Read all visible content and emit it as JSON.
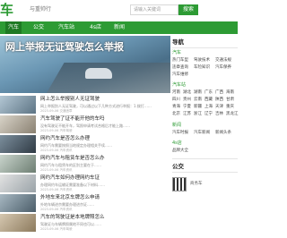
{
  "header": {
    "logo": "车",
    "tagline": "与重帅行",
    "search_placeholder": "请输入关键词",
    "search_button": "搜索"
  },
  "nav": [
    "汽车",
    "公交",
    "汽车站",
    "4s店",
    "新闻"
  ],
  "banner": {
    "title": "网上举报无证驾驶怎么举报"
  },
  "articles": [
    {
      "title": "网上怎么举报别人无证驾驶",
      "desc": "网上举报别人无证驾驶，可以通过以下几种方式进行举报：1.拨打……",
      "meta": "2023-09-06 交通违章"
    },
    {
      "title": "汽车驾驶了证不能开他的车吗",
      "desc": "没有驾驶证不能开车，驾照申请考试合格后才能上路……",
      "meta": "2023-09-06 汽车驾驶"
    },
    {
      "title": "网约汽车是否怎么办理",
      "desc": "网约汽车需要按照当地规定办理相关手续……",
      "meta": "2023-09-06 汽车资讯"
    },
    {
      "title": "网约汽车与租赁车是否怎么办",
      "desc": "网约汽车与租赁车的区别主要在于……",
      "meta": "2023-09-06 汽车资讯"
    },
    {
      "title": "网约汽车如何办理网约车证",
      "desc": "办理网约车运输证需要准备以下材料……",
      "meta": "2023-09-06 汽车资讯"
    },
    {
      "title": "外地车来北京车牌怎么申请",
      "desc": "外地车辆进京需要办理进京证……",
      "meta": "2023-09-06 汽车资讯"
    },
    {
      "title": "汽车的驾驶证是本地牌照怎么",
      "desc": "驾驶证与车辆牌照属地不同也可以……",
      "meta": "2023-09-06 汽车驾驶"
    }
  ],
  "sidebar": {
    "nav_title": "导航",
    "car_label": "汽车",
    "car_links": [
      "热门车型",
      "驾驶技术",
      "交通法规",
      "违章查询",
      "车险知识",
      "汽车保养",
      "汽车维修"
    ],
    "region_label": "汽车站",
    "regions": [
      "河南",
      "湖北",
      "湖南",
      "广东",
      "广西",
      "海南",
      "四川",
      "贵州",
      "云南",
      "西藏",
      "陕西",
      "甘肃",
      "青海",
      "宁夏",
      "新疆",
      "上海",
      "天津",
      "重庆",
      "北京",
      "江苏",
      "浙江",
      "辽宁",
      "吉林",
      "黑龙江"
    ],
    "news_label": "新闻",
    "news_links": [
      "汽车时报",
      "汽车新闻",
      "新闻头条"
    ],
    "store_label": "4s店",
    "store_links": [
      "品牌大全"
    ],
    "public_label": "公交",
    "qr_text": "商务车"
  },
  "colors": {
    "brand": "#2d9b34"
  }
}
